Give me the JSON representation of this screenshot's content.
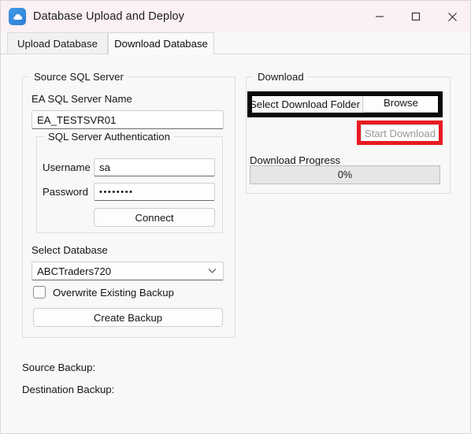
{
  "window": {
    "title": "Database Upload and Deploy",
    "app_icon": "cloud-icon",
    "controls": {
      "minimize": "minimize-icon",
      "maximize": "maximize-icon",
      "close": "close-icon"
    },
    "titlebar_color": "#fbf0f3"
  },
  "tabs": [
    {
      "label": "Upload Database",
      "active": false
    },
    {
      "label": "Download Database",
      "active": true
    }
  ],
  "source_panel": {
    "group_title": "Source SQL Server",
    "server_name_label": "EA SQL Server Name",
    "server_name_value": "EA_TESTSVR01",
    "auth": {
      "group_title": "SQL Server Authentication",
      "username_label": "Username",
      "username_value": "sa",
      "password_label": "Password",
      "password_value": "••••••••",
      "connect_label": "Connect"
    },
    "select_database_label": "Select Database",
    "selected_database": "ABCTraders720",
    "database_options": [
      "ABCTraders720"
    ],
    "overwrite_label": "Overwrite Existing Backup",
    "overwrite_checked": false,
    "create_backup_label": "Create Backup"
  },
  "download_panel": {
    "group_title": "Download",
    "select_folder_label": "Select Download Folder",
    "browse_label": "Browse",
    "start_download_label": "Start Download",
    "start_download_enabled": false,
    "progress_label": "Download Progress",
    "progress_value": "0%",
    "progress_percent": 0
  },
  "status": {
    "source_backup_label": "Source Backup:",
    "destination_backup_label": "Destination Backup:"
  },
  "annotations": {
    "folder_box_color": "#0a0a0a",
    "start_download_box_color": "#e81a21"
  }
}
